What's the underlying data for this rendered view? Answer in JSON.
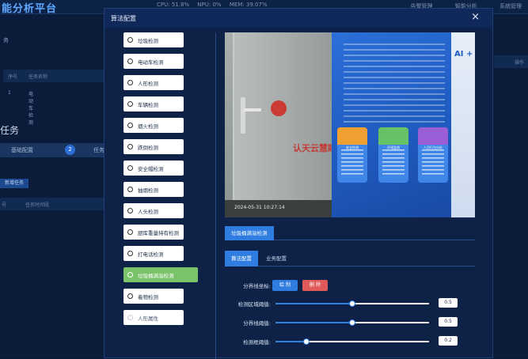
{
  "background": {
    "title": "能分析平台",
    "stats": [
      "CPU: 51.8%",
      "NPU: 0%",
      "MEM: 39.07%"
    ],
    "top_links": [
      "告警管理",
      "智能分析",
      "系统管理"
    ],
    "section_label": "务",
    "table_headers": [
      "序号",
      "任务名称"
    ],
    "row": [
      "1",
      "电动车检测"
    ],
    "task_title": "任务",
    "steps": [
      "基础配置",
      "2",
      "任务"
    ],
    "add_button": "新增任务",
    "table2_headers": [
      "号",
      "任务时间段"
    ],
    "right_header": "操作"
  },
  "modal": {
    "title": "算法配置",
    "close_icon": "×"
  },
  "algorithms": [
    {
      "label": "垃圾检测",
      "state": "normal"
    },
    {
      "label": "电动车检测",
      "state": "normal"
    },
    {
      "label": "人形检测",
      "state": "normal"
    },
    {
      "label": "车辆检测",
      "state": "normal"
    },
    {
      "label": "烟火检测",
      "state": "normal"
    },
    {
      "label": "跌倒检测",
      "state": "normal"
    },
    {
      "label": "安全帽检测",
      "state": "normal"
    },
    {
      "label": "抽烟检测",
      "state": "normal"
    },
    {
      "label": "人头检测",
      "state": "normal"
    },
    {
      "label": "厨库重量持有检测",
      "state": "normal"
    },
    {
      "label": "打电话检测",
      "state": "normal"
    },
    {
      "label": "垃圾桶满溢检测",
      "state": "active"
    },
    {
      "label": "着物检测",
      "state": "normal"
    },
    {
      "label": "人形属性",
      "state": "dim"
    }
  ],
  "preview": {
    "timestamp": "2024-05-31 10:27:14",
    "logo_text": "认天云慧眼",
    "side_text": "AI +",
    "cards": [
      "安全检测",
      "环境监测",
      "人员行为分析"
    ]
  },
  "algo_tag": "垃圾桶满溢检测",
  "tabs": [
    "算法配置",
    "业务配置"
  ],
  "form": {
    "zone_label": "分界线坐标:",
    "draw_button": "绘 制",
    "delete_button": "删 除",
    "sliders": [
      {
        "label": "检测区域阈值:",
        "value": "0.5",
        "fraction": 0.5
      },
      {
        "label": "分界线阈值:",
        "value": "0.5",
        "fraction": 0.5
      },
      {
        "label": "检测框阈值:",
        "value": "0.2",
        "fraction": 0.2
      }
    ]
  },
  "colors": {
    "accent": "#2f7de0",
    "active_item": "#7ac36a",
    "danger": "#e05a5a",
    "panel": "#0e2248"
  }
}
